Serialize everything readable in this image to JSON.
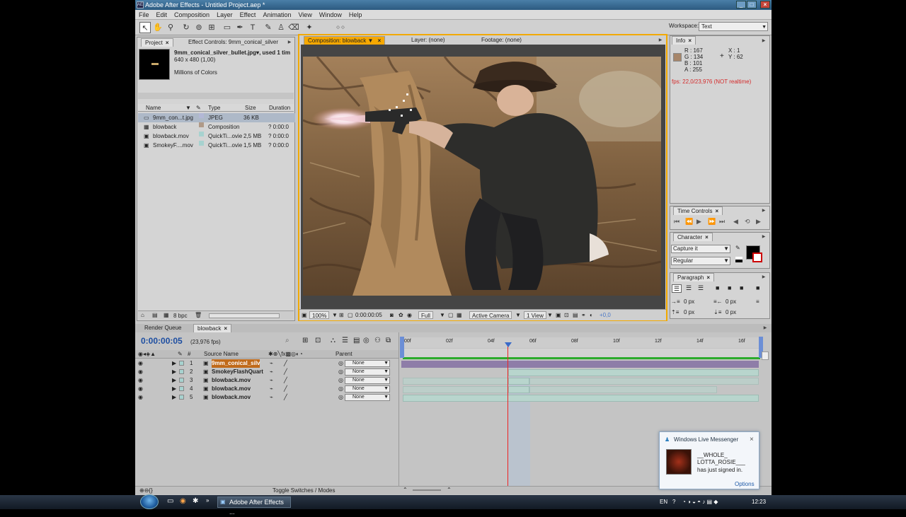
{
  "window": {
    "title": "Adobe After Effects - Untitled Project.aep *",
    "icon": "AE"
  },
  "menu": [
    "File",
    "Edit",
    "Composition",
    "Layer",
    "Effect",
    "Animation",
    "View",
    "Window",
    "Help"
  ],
  "workspace": {
    "label": "Workspace:",
    "value": "Text"
  },
  "project_panel": {
    "tab_project": "Project",
    "tab_effects": "Effect Controls: 9mm_conical_silver",
    "selected_name": "9mm_conical_silver_bullet.jpg▾, used 1 tim",
    "selected_dims": "640 x 480 (1,00)",
    "selected_colors": "Millions of Colors",
    "columns": [
      "Name",
      "Type",
      "Size",
      "Duration"
    ],
    "items": [
      {
        "name": "9mm_con...t.jpg",
        "type": "JPEG",
        "size": "36 KB",
        "duration": "",
        "swatch": "#b3b8d6"
      },
      {
        "name": "blowback",
        "type": "Composition",
        "size": "",
        "duration": "? 0:00:0",
        "swatch": "#b09a88"
      },
      {
        "name": "blowback.mov",
        "type": "QuickTi...ovie",
        "size": "2,5 MB",
        "duration": "? 0:00:0",
        "swatch": "#a7d2cf"
      },
      {
        "name": "SmokeyF....mov",
        "type": "QuickTi...ovie",
        "size": "1,5 MB",
        "duration": "? 0:00:0",
        "swatch": "#a7d2cf"
      }
    ],
    "bpc": "8 bpc"
  },
  "viewer": {
    "tab_comp": "Composition: blowback",
    "tab_layer": "Layer: (none)",
    "tab_footage": "Footage: (none)",
    "zoom": "100%",
    "timecode": "0:00:00:05",
    "resolution": "Full",
    "camera": "Active Camera",
    "views": "1 View",
    "exposure": "+0,0"
  },
  "info_panel": {
    "tab": "Info",
    "r": "R : 167",
    "g": "G : 134",
    "b": "B : 101",
    "a": "A : 255",
    "x": "X : 1",
    "y": "Y : 62",
    "fps": "fps: 22,0/23,976 (NOT realtime)",
    "swatch": "#a7866a"
  },
  "time_controls": {
    "tab": "Time Controls"
  },
  "character": {
    "tab": "Character",
    "font": "Capture it",
    "style": "Regular"
  },
  "paragraph": {
    "tab": "Paragraph",
    "indent_left": "0 px",
    "indent_right": "0 px",
    "space_before": "0 px",
    "space_after": "0 px"
  },
  "timeline": {
    "tab_render": "Render Queue",
    "tab_comp": "blowback",
    "timecode": "0:00:00:05",
    "fps": "(23,976 fps)",
    "col_source": "Source Name",
    "col_parent": "Parent",
    "col_num": "#",
    "ruler": [
      "00f",
      "02f",
      "04f",
      "06f",
      "08f",
      "10f",
      "12f",
      "14f",
      "16f"
    ],
    "layers": [
      {
        "num": "1",
        "name": "9mm_conical_silv",
        "parent": "None"
      },
      {
        "num": "2",
        "name": "SmokeyFlashQuart",
        "parent": "None"
      },
      {
        "num": "3",
        "name": "blowback.mov",
        "parent": "None"
      },
      {
        "num": "4",
        "name": "blowback.mov",
        "parent": "None"
      },
      {
        "num": "5",
        "name": "blowback.mov",
        "parent": "None"
      }
    ],
    "toggle_label": "Toggle Switches / Modes"
  },
  "notification": {
    "title": "Windows Live Messenger",
    "user_line1": "__WHOLE_",
    "user_line2": "LOTTA_ROSIE___",
    "message": "has just signed in.",
    "options": "Options"
  },
  "taskbar": {
    "task": "Adobe After Effects ...",
    "lang": "EN",
    "clock": "12:23"
  }
}
